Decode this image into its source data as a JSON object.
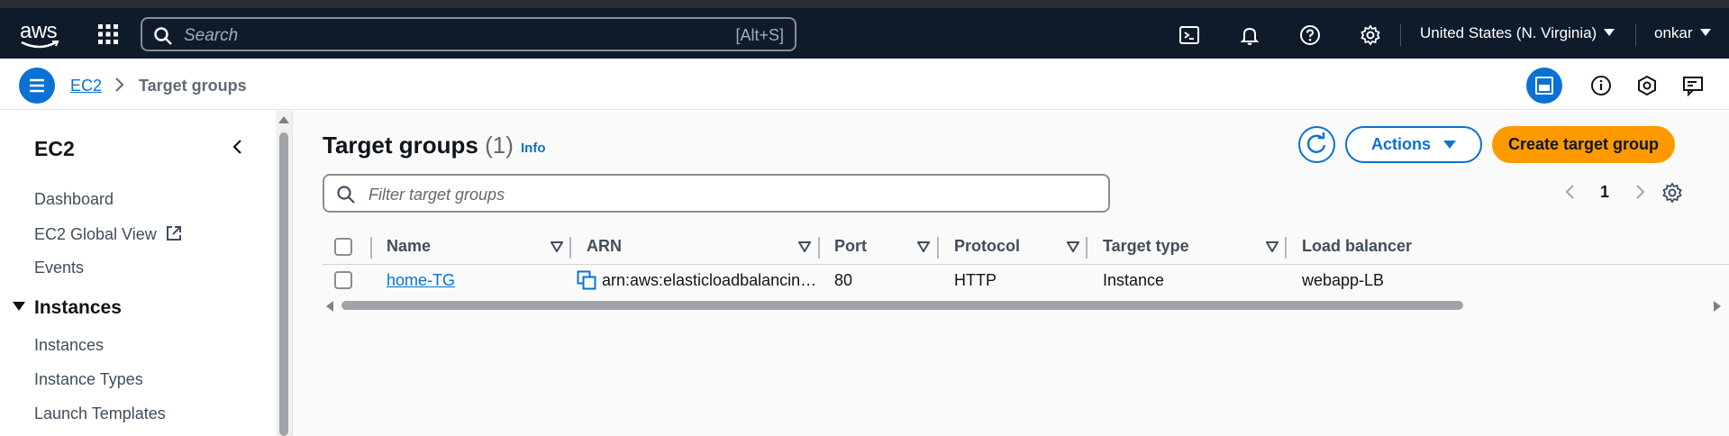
{
  "topnav": {
    "logo_text": "aws",
    "search_placeholder": "Search",
    "search_shortcut": "[Alt+S]",
    "region": "United States (N. Virginia)",
    "user": "onkar"
  },
  "breadcrumb": {
    "items": [
      "EC2",
      "Target groups"
    ]
  },
  "sidebar": {
    "title": "EC2",
    "links": [
      "Dashboard",
      "EC2 Global View",
      "Events"
    ],
    "section": "Instances",
    "section_links": [
      "Instances",
      "Instance Types",
      "Launch Templates"
    ]
  },
  "main": {
    "title": "Target groups",
    "count": "(1)",
    "info": "Info",
    "actions_label": "Actions",
    "create_label": "Create target group",
    "filter_placeholder": "Filter target groups",
    "page_number": "1"
  },
  "table": {
    "columns": [
      "Name",
      "ARN",
      "Port",
      "Protocol",
      "Target type",
      "Load balancer"
    ],
    "rows": [
      {
        "name": "home-TG",
        "arn": "arn:aws:elasticloadbalancin…",
        "port": "80",
        "protocol": "HTTP",
        "target_type": "Instance",
        "load_balancer": "webapp-LB"
      }
    ]
  },
  "colors": {
    "nav_bg": "#0f1b2a",
    "accent_blue": "#0972d3",
    "primary_orange": "#ff9900"
  }
}
